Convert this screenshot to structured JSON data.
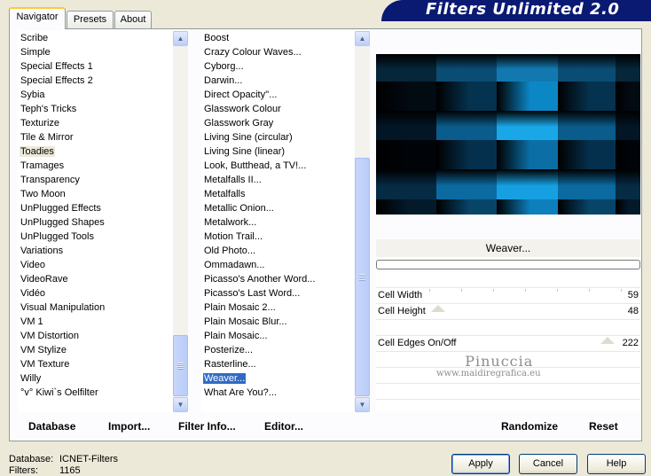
{
  "tabs": [
    {
      "label": "Navigator",
      "active": true
    },
    {
      "label": "Presets",
      "active": false
    },
    {
      "label": "About",
      "active": false
    }
  ],
  "banner": {
    "title": "Filters Unlimited 2.0"
  },
  "categories": [
    "Scribe",
    "Simple",
    "Special Effects 1",
    "Special Effects 2",
    "Sybia",
    "Teph's Tricks",
    "Texturize",
    "Tile & Mirror",
    "Toadies",
    "Tramages",
    "Transparency",
    "Two Moon",
    "UnPlugged Effects",
    "UnPlugged Shapes",
    "UnPlugged Tools",
    "Variations",
    "Video",
    "VideoRave",
    "Vidéo",
    "Visual Manipulation",
    "VM 1",
    "VM Distortion",
    "VM Stylize",
    "VM Texture",
    "Willy",
    "°v° Kiwi`s Oelfilter"
  ],
  "selected_category": "Toadies",
  "filters": [
    "Boost",
    "Crazy Colour Waves...",
    "Cyborg...",
    "Darwin...",
    "Direct Opacity''...",
    "Glasswork Colour",
    "Glasswork Gray",
    "Living Sine (circular)",
    "Living Sine (linear)",
    "Look, Butthead, a TV!...",
    "Metalfalls II...",
    "Metalfalls",
    "Metallic Onion...",
    "Metalwork...",
    "Motion Trail...",
    "Old Photo...",
    "Ommadawn...",
    "Picasso's Another Word...",
    "Picasso's Last Word...",
    "Plain Mosaic 2...",
    "Plain Mosaic Blur...",
    "Plain Mosaic...",
    "Posterize...",
    "Rasterline...",
    "Weaver...",
    "What Are You?..."
  ],
  "selected_filter": "Weaver...",
  "filter_name": "Weaver...",
  "progress": 0,
  "params": [
    {
      "label": "Cell Width",
      "value": "59"
    },
    {
      "label": "Cell Height",
      "value": "48"
    },
    {
      "label": "Cell Edges On/Off",
      "value": "222"
    }
  ],
  "watermark": {
    "name": "Pinuccia",
    "url": "www.maidiregrafica.eu"
  },
  "buttons": {
    "database": "Database",
    "import": "Import...",
    "filter_info": "Filter Info...",
    "editor": "Editor...",
    "randomize": "Randomize",
    "reset": "Reset",
    "apply": "Apply",
    "cancel": "Cancel",
    "help": "Help"
  },
  "status": {
    "database_label": "Database:",
    "database_value": "ICNET-Filters",
    "filters_label": "Filters:",
    "filters_value": "1165"
  },
  "icons": {
    "scroll_up": "arrow-up-icon",
    "scroll_down": "arrow-down-icon"
  },
  "colors": {
    "banner": "#0a1a73",
    "selection": "#316ac5",
    "preview_blue": "#0aa0e0"
  }
}
